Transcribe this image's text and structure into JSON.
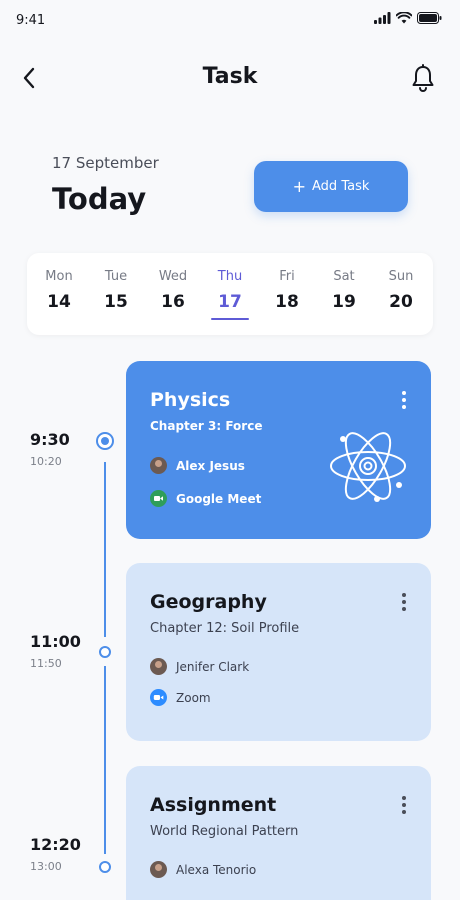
{
  "status_bar": {
    "time": "9:41"
  },
  "header": {
    "title": "Task"
  },
  "date_heading": {
    "date": "17 September",
    "label": "Today"
  },
  "add_task_button": {
    "label": "Add Task"
  },
  "week": [
    {
      "day": "Mon",
      "date": "14"
    },
    {
      "day": "Tue",
      "date": "15"
    },
    {
      "day": "Wed",
      "date": "16"
    },
    {
      "day": "Thu",
      "date": "17",
      "active": true
    },
    {
      "day": "Fri",
      "date": "18"
    },
    {
      "day": "Sat",
      "date": "19"
    },
    {
      "day": "Sun",
      "date": "20"
    }
  ],
  "tasks": [
    {
      "start": "9:30",
      "end": "10:20",
      "title": "Physics",
      "subtitle": "Chapter 3: Force",
      "person": "Alex Jesus",
      "platform": "Google Meet",
      "platform_icon": "google-meet-icon",
      "style": "highlighted",
      "illustration": "atom-icon"
    },
    {
      "start": "11:00",
      "end": "11:50",
      "title": "Geography",
      "subtitle": "Chapter 12: Soil Profile",
      "person": "Jenifer Clark",
      "platform": "Zoom",
      "platform_icon": "zoom-icon",
      "style": "normal"
    },
    {
      "start": "12:20",
      "end": "13:00",
      "title": "Assignment",
      "subtitle": "World Regional Pattern",
      "person": "Alexa Tenorio",
      "style": "normal"
    }
  ],
  "colors": {
    "accent": "#4d8ee9",
    "active_day": "#5e5bd6",
    "card_light": "#d6e5f9"
  }
}
